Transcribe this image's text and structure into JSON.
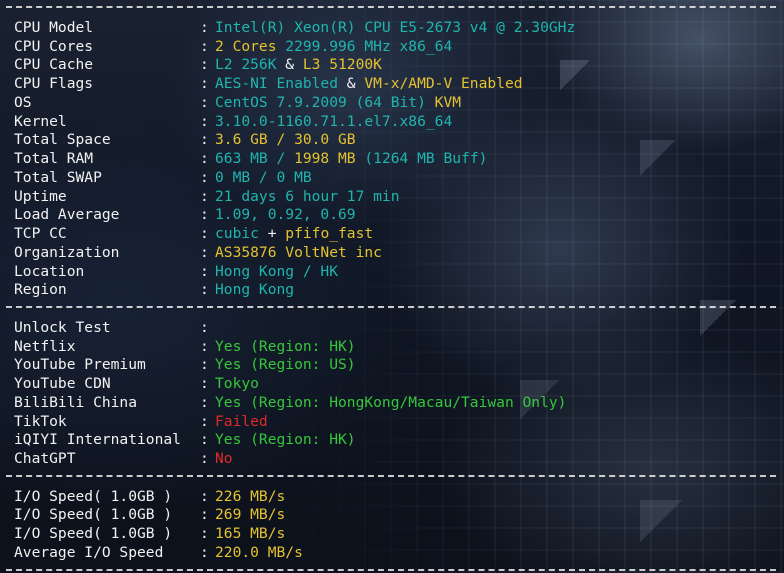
{
  "colors": {
    "label": "#f2f2f2",
    "cyan": "#1fb5ad",
    "yellow": "#e4c230",
    "green": "#35c83a",
    "red": "#e02a2a"
  },
  "system": [
    {
      "key": "cpu-model",
      "label": "CPU Model",
      "parts": [
        {
          "t": "Intel(R) Xeon(R) CPU E5-2673 v4 @ 2.30GHz",
          "c": "cyan"
        }
      ]
    },
    {
      "key": "cpu-cores",
      "label": "CPU Cores",
      "parts": [
        {
          "t": "2 Cores",
          "c": "yellow"
        },
        {
          "t": " 2299.996 MHz x86_64",
          "c": "cyan"
        }
      ]
    },
    {
      "key": "cpu-cache",
      "label": "CPU Cache",
      "parts": [
        {
          "t": "L2 256K",
          "c": "cyan"
        },
        {
          "t": " & ",
          "c": "white"
        },
        {
          "t": "L3 51200K",
          "c": "yellow"
        }
      ]
    },
    {
      "key": "cpu-flags",
      "label": "CPU Flags",
      "parts": [
        {
          "t": "AES-NI Enabled",
          "c": "cyan"
        },
        {
          "t": " & ",
          "c": "white"
        },
        {
          "t": "VM-x/AMD-V Enabled",
          "c": "yellow"
        }
      ]
    },
    {
      "key": "os",
      "label": "OS",
      "parts": [
        {
          "t": "CentOS 7.9.2009 (64 Bit)",
          "c": "cyan"
        },
        {
          "t": " KVM",
          "c": "yellow"
        }
      ]
    },
    {
      "key": "kernel",
      "label": "Kernel",
      "parts": [
        {
          "t": "3.10.0-1160.71.1.el7.x86_64",
          "c": "cyan"
        }
      ]
    },
    {
      "key": "total-space",
      "label": "Total Space",
      "parts": [
        {
          "t": "3.6 GB / 30.0 GB",
          "c": "yellow"
        }
      ]
    },
    {
      "key": "total-ram",
      "label": "Total RAM",
      "parts": [
        {
          "t": "663 MB / ",
          "c": "cyan"
        },
        {
          "t": "1998 MB",
          "c": "yellow"
        },
        {
          "t": " (1264 MB Buff)",
          "c": "cyan"
        }
      ]
    },
    {
      "key": "total-swap",
      "label": "Total SWAP",
      "parts": [
        {
          "t": "0 MB / 0 MB",
          "c": "cyan"
        }
      ]
    },
    {
      "key": "uptime",
      "label": "Uptime",
      "parts": [
        {
          "t": "21 days 6 hour 17 min",
          "c": "cyan"
        }
      ]
    },
    {
      "key": "load-average",
      "label": "Load Average",
      "parts": [
        {
          "t": "1.09, 0.92, 0.69",
          "c": "cyan"
        }
      ]
    },
    {
      "key": "tcp-cc",
      "label": "TCP CC",
      "parts": [
        {
          "t": "cubic",
          "c": "cyan"
        },
        {
          "t": " + ",
          "c": "white"
        },
        {
          "t": "pfifo_fast",
          "c": "yellow"
        }
      ]
    },
    {
      "key": "organization",
      "label": "Organization",
      "parts": [
        {
          "t": "AS35876 VoltNet inc",
          "c": "yellow"
        }
      ]
    },
    {
      "key": "location",
      "label": "Location",
      "parts": [
        {
          "t": "Hong Kong / HK",
          "c": "cyan"
        }
      ]
    },
    {
      "key": "region",
      "label": "Region",
      "parts": [
        {
          "t": "Hong Kong",
          "c": "cyan"
        }
      ]
    }
  ],
  "unlock": [
    {
      "key": "unlock-test",
      "label": "Unlock Test",
      "parts": []
    },
    {
      "key": "netflix",
      "label": "Netflix",
      "parts": [
        {
          "t": "Yes (Region: HK)",
          "c": "green"
        }
      ]
    },
    {
      "key": "youtube-premium",
      "label": "YouTube Premium",
      "parts": [
        {
          "t": "Yes (Region: US)",
          "c": "green"
        }
      ]
    },
    {
      "key": "youtube-cdn",
      "label": "YouTube CDN",
      "parts": [
        {
          "t": "Tokyo",
          "c": "green"
        }
      ]
    },
    {
      "key": "bilibili-china",
      "label": "BiliBili China",
      "parts": [
        {
          "t": "Yes (Region: HongKong/Macau/Taiwan Only)",
          "c": "green"
        }
      ]
    },
    {
      "key": "tiktok",
      "label": "TikTok",
      "parts": [
        {
          "t": "Failed",
          "c": "red"
        }
      ]
    },
    {
      "key": "iqiyi-international",
      "label": "iQIYI International",
      "parts": [
        {
          "t": "Yes (Region: HK)",
          "c": "green"
        }
      ]
    },
    {
      "key": "chatgpt",
      "label": "ChatGPT",
      "parts": [
        {
          "t": "No",
          "c": "red"
        }
      ]
    }
  ],
  "io": [
    {
      "key": "io-speed-1",
      "label": "I/O Speed( 1.0GB )",
      "parts": [
        {
          "t": "226 MB/s",
          "c": "yellow"
        }
      ]
    },
    {
      "key": "io-speed-2",
      "label": "I/O Speed( 1.0GB )",
      "parts": [
        {
          "t": "269 MB/s",
          "c": "yellow"
        }
      ]
    },
    {
      "key": "io-speed-3",
      "label": "I/O Speed( 1.0GB )",
      "parts": [
        {
          "t": "165 MB/s",
          "c": "yellow"
        }
      ]
    },
    {
      "key": "io-speed-average",
      "label": "Average I/O Speed",
      "parts": [
        {
          "t": "220.0 MB/s",
          "c": "yellow"
        }
      ]
    }
  ],
  "colon": ":"
}
